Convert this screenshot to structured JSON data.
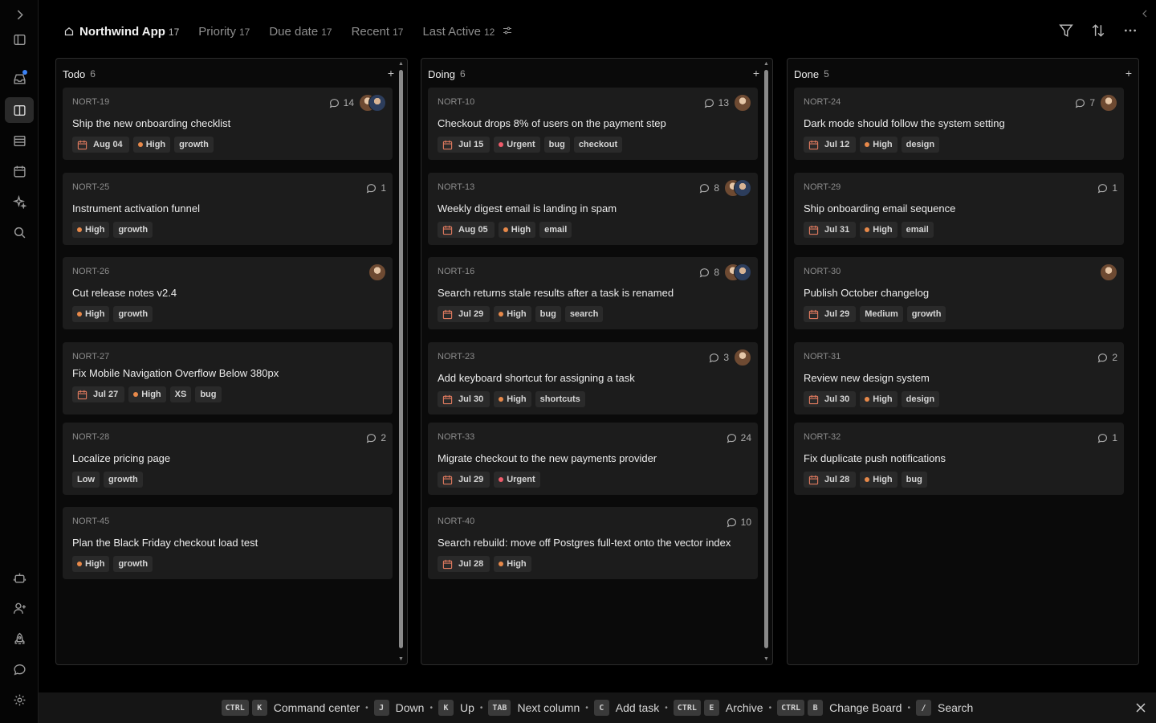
{
  "header": {
    "views": [
      {
        "label": "Northwind App",
        "count": "17"
      },
      {
        "label": "Priority",
        "count": "17"
      },
      {
        "label": "Due date",
        "count": "17"
      },
      {
        "label": "Recent",
        "count": "17"
      },
      {
        "label": "Last Active",
        "count": "12"
      }
    ]
  },
  "icons": {
    "rail": [
      "expand-icon",
      "sidebar-icon",
      "inbox-icon",
      "board-icon",
      "list-icon",
      "calendar-icon",
      "sparkle-icon",
      "search-icon",
      "bot-icon",
      "add-user-icon",
      "rocket-icon",
      "chat-icon",
      "settings-icon"
    ],
    "tools": [
      "filter-icon",
      "sort-icon",
      "more-icon"
    ]
  },
  "colors": {
    "high": "#e8894a",
    "urgent": "#ef5b6a",
    "accent": "#3b82f6",
    "date_icon": "#e07a5f"
  },
  "columns": [
    {
      "title": "Todo",
      "count": "6",
      "cards": [
        {
          "id": "NORT-19",
          "title": "Ship the new onboarding checklist",
          "comments": "14",
          "avatars": 2,
          "date": "Aug 04",
          "priority": "High",
          "labels": [
            "growth"
          ]
        },
        {
          "id": "NORT-25",
          "title": "Instrument activation funnel",
          "comments": "1",
          "avatars": 0,
          "date": "",
          "priority": "High",
          "labels": [
            "growth"
          ]
        },
        {
          "id": "NORT-26",
          "title": "Cut release notes v2.4",
          "comments": "",
          "avatars": 1,
          "date": "",
          "priority": "High",
          "labels": [
            "growth"
          ]
        },
        {
          "id": "NORT-27",
          "title": "Fix Mobile Navigation Overflow Below 380px",
          "comments": "",
          "avatars": 0,
          "date": "Jul 27",
          "priority": "High",
          "labels": [
            "XS",
            "bug"
          ]
        },
        {
          "id": "NORT-28",
          "title": "Localize pricing page",
          "comments": "2",
          "avatars": 0,
          "date": "",
          "priority": "",
          "labels": [
            "Low",
            "growth"
          ]
        },
        {
          "id": "NORT-45",
          "title": "Plan the Black Friday checkout load test",
          "comments": "",
          "avatars": 0,
          "date": "",
          "priority": "High",
          "labels": [
            "growth"
          ]
        }
      ]
    },
    {
      "title": "Doing",
      "count": "6",
      "cards": [
        {
          "id": "NORT-10",
          "title": "Checkout drops 8% of users on the payment step",
          "comments": "13",
          "avatars": 1,
          "date": "Jul 15",
          "priority": "Urgent",
          "labels": [
            "bug",
            "checkout"
          ]
        },
        {
          "id": "NORT-13",
          "title": "Weekly digest email is landing in spam",
          "comments": "8",
          "avatars": 2,
          "date": "Aug 05",
          "priority": "High",
          "labels": [
            "email"
          ]
        },
        {
          "id": "NORT-16",
          "title": "Search returns stale results after a task is renamed",
          "comments": "8",
          "avatars": 2,
          "date": "Jul 29",
          "priority": "High",
          "labels": [
            "bug",
            "search"
          ]
        },
        {
          "id": "NORT-23",
          "title": "Add keyboard shortcut for assigning a task",
          "comments": "3",
          "avatars": 1,
          "date": "Jul 30",
          "priority": "High",
          "labels": [
            "shortcuts"
          ]
        },
        {
          "id": "NORT-33",
          "title": "Migrate checkout to the new payments provider",
          "comments": "24",
          "avatars": 0,
          "date": "Jul 29",
          "priority": "Urgent",
          "labels": []
        },
        {
          "id": "NORT-40",
          "title": "Search rebuild: move off Postgres full-text onto the vector index",
          "comments": "10",
          "avatars": 0,
          "date": "Jul 28",
          "priority": "High",
          "labels": []
        }
      ]
    },
    {
      "title": "Done",
      "count": "5",
      "cards": [
        {
          "id": "NORT-24",
          "title": "Dark mode should follow the system setting",
          "comments": "7",
          "avatars": 1,
          "date": "Jul 12",
          "priority": "High",
          "labels": [
            "design"
          ]
        },
        {
          "id": "NORT-29",
          "title": "Ship onboarding email sequence",
          "comments": "1",
          "avatars": 0,
          "date": "Jul 31",
          "priority": "High",
          "labels": [
            "email"
          ]
        },
        {
          "id": "NORT-30",
          "title": "Publish October changelog",
          "comments": "",
          "avatars": 1,
          "date": "Jul 29",
          "priority": "",
          "labels": [
            "Medium",
            "growth"
          ]
        },
        {
          "id": "NORT-31",
          "title": "Review new design system",
          "comments": "2",
          "avatars": 0,
          "date": "Jul 30",
          "priority": "High",
          "labels": [
            "design"
          ]
        },
        {
          "id": "NORT-32",
          "title": "Fix duplicate push notifications",
          "comments": "1",
          "avatars": 0,
          "date": "Jul 28",
          "priority": "High",
          "labels": [
            "bug"
          ]
        }
      ]
    }
  ],
  "shortcuts": [
    {
      "keys": [
        "CTRL",
        "K"
      ],
      "label": "Command center"
    },
    {
      "keys": [
        "J"
      ],
      "label": "Down"
    },
    {
      "keys": [
        "K"
      ],
      "label": "Up"
    },
    {
      "keys": [
        "TAB"
      ],
      "label": "Next column"
    },
    {
      "keys": [
        "C"
      ],
      "label": "Add task"
    },
    {
      "keys": [
        "CTRL",
        "E"
      ],
      "label": "Archive"
    },
    {
      "keys": [
        "CTRL",
        "B"
      ],
      "label": "Change Board"
    },
    {
      "keys": [
        "/"
      ],
      "label": "Search"
    }
  ]
}
